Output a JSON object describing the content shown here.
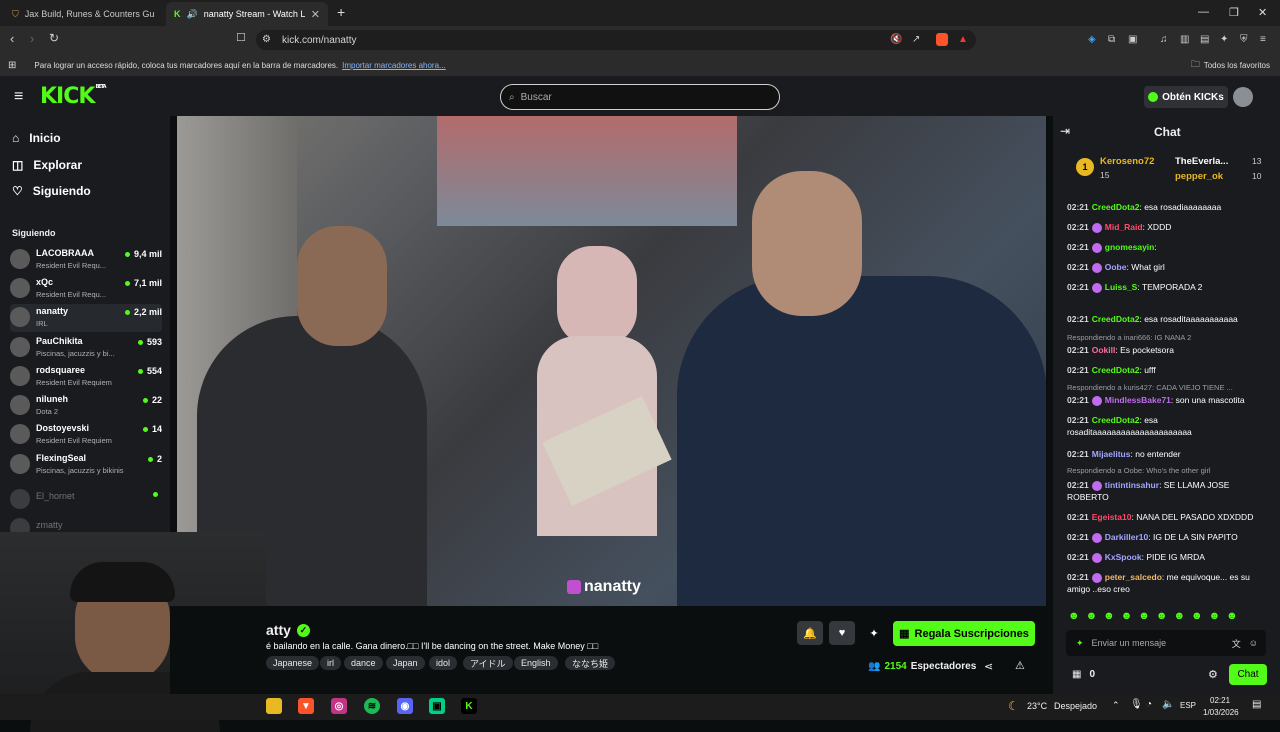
{
  "browser": {
    "tabs": [
      {
        "title": "Jax Build, Runes & Counters Guide fo"
      },
      {
        "title": "nanatty Stream - Watch Live"
      }
    ],
    "url": "kick.com/nanatty",
    "bookmarks_hint": "Para lograr un acceso rápido, coloca tus marcadores aquí en la barra de marcadores.",
    "bookmarks_link": "Importar marcadores ahora...",
    "favorites": "Todos los favoritos"
  },
  "header": {
    "logo": "KICK",
    "logo_sup": "BETA",
    "search_placeholder": "Buscar",
    "get_kicks": "Obtén KICKs"
  },
  "sidebar": {
    "nav": [
      "Inicio",
      "Explorar",
      "Siguiendo"
    ],
    "following_title": "Siguiendo",
    "channels": [
      {
        "name": "LACOBRAAA",
        "category": "Resident Evil Requ...",
        "viewers": "9,4 mil"
      },
      {
        "name": "xQc",
        "category": "Resident Evil Requ...",
        "viewers": "7,1 mil"
      },
      {
        "name": "nanatty",
        "category": "IRL",
        "viewers": "2,2 mil"
      },
      {
        "name": "PauChikita",
        "category": "Piscinas, jacuzzis y bi...",
        "viewers": "593"
      },
      {
        "name": "rodsquaree",
        "category": "Resident Evil Requiem",
        "viewers": "554"
      },
      {
        "name": "niluneh",
        "category": "Dota 2",
        "viewers": "22"
      },
      {
        "name": "Dostoyevski",
        "category": "Resident Evil Requiem",
        "viewers": "14"
      },
      {
        "name": "FlexingSeal",
        "category": "Piscinas, jacuzzis y bikinis",
        "viewers": "2"
      }
    ],
    "offline": [
      "El_hornet",
      "zmatty"
    ]
  },
  "video": {
    "watermark": "nanatty"
  },
  "stream": {
    "name_fragment": "atty",
    "title": "é bailando en la calle. Gana dinero.□□ I'll be dancing on the street. Make Money □□",
    "tags": [
      "Japanese",
      "irl",
      "dance",
      "Japan",
      "idol",
      "アイドル",
      "English",
      "ななち姫"
    ],
    "gift_label": "Regala Suscripciones",
    "viewers": "2154",
    "viewers_label": "Espectadores"
  },
  "chat": {
    "title": "Chat",
    "leaderboard": [
      {
        "rank": "1",
        "name": "Keroseno72",
        "points": "15"
      },
      {
        "name": "TheEverla...",
        "points": "13"
      },
      {
        "name": "pepper_ok",
        "points": "10"
      }
    ],
    "messages": [
      {
        "type": "msg",
        "time": "02:21",
        "user": "CreedDota2",
        "color": "#53fc18",
        "text": "esa rosadiaaaaaaaa"
      },
      {
        "type": "msg",
        "time": "02:21",
        "user": "Mid_Raid",
        "color": "#ff4b6b",
        "text": "XDDD",
        "badge": true
      },
      {
        "type": "msg",
        "time": "02:21",
        "user": "gnomesayin",
        "color": "#53fc18",
        "text": "",
        "badge": true
      },
      {
        "type": "msg",
        "time": "02:21",
        "user": "Oobe",
        "color": "#a3a6ff",
        "text": "What girl",
        "badge": true
      },
      {
        "type": "msg",
        "time": "02:21",
        "user": "Luiss_S",
        "color": "#53fc18",
        "text": "TEMPORADA 2",
        "badge": true
      },
      {
        "type": "msg",
        "time": "02:21",
        "user": "CreedDota2",
        "color": "#53fc18",
        "text": "esa rosaditaaaaaaaaaaa"
      },
      {
        "type": "reply",
        "text": "Respondiendo a inari666: IG NANA 2"
      },
      {
        "type": "msg",
        "time": "02:21",
        "user": "Ookill",
        "color": "#ff6b9d",
        "text": "Es pocketsora"
      },
      {
        "type": "msg",
        "time": "02:21",
        "user": "CreedDota2",
        "color": "#53fc18",
        "text": "ufff"
      },
      {
        "type": "reply",
        "text": "Respondiendo a kuris427: CADA VIEJO TIENE ..."
      },
      {
        "type": "msg",
        "time": "02:21",
        "user": "MindlessBake71",
        "color": "#c06cf0",
        "text": "son una mascotita",
        "badge": true
      },
      {
        "type": "msg",
        "time": "02:21",
        "user": "CreedDota2",
        "color": "#53fc18",
        "text": "esa rosaditaaaaaaaaaaaaaaaaaaaaa"
      },
      {
        "type": "msg",
        "time": "02:21",
        "user": "Mijaelitus",
        "color": "#a3a6ff",
        "text": "no entender"
      },
      {
        "type": "reply",
        "text": "Respondiendo a Oobe: Who's the other girl"
      },
      {
        "type": "msg",
        "time": "02:21",
        "user": "tintintinsahur",
        "color": "#a3a6ff",
        "text": "SE LLAMA JOSE ROBERTO",
        "badge": true
      },
      {
        "type": "msg",
        "time": "02:21",
        "user": "Egeista10",
        "color": "#ff4b6b",
        "text": "NANA DEL PASADO XDXDDD"
      },
      {
        "type": "msg",
        "time": "02:21",
        "user": "Darkiller10",
        "color": "#a3a6ff",
        "text": "IG DE LA SIN PAPITO",
        "badge": true
      },
      {
        "type": "msg",
        "time": "02:21",
        "user": "KxSpook",
        "color": "#a3a6ff",
        "text": "PIDE IG MRDA",
        "badge": true
      },
      {
        "type": "msg",
        "time": "02:21",
        "user": "peter_salcedo",
        "color": "#f0b86c",
        "text": "me equivoque... es su amigo ..eso creo",
        "badge": true
      }
    ],
    "input_placeholder": "Enviar un mensaje",
    "kicks_count": "0",
    "send_label": "Chat"
  },
  "taskbar": {
    "weather": "23°C",
    "weather_desc": "Despejado",
    "lang": "ESP",
    "time": "02:21",
    "date": "1/03/2026"
  }
}
